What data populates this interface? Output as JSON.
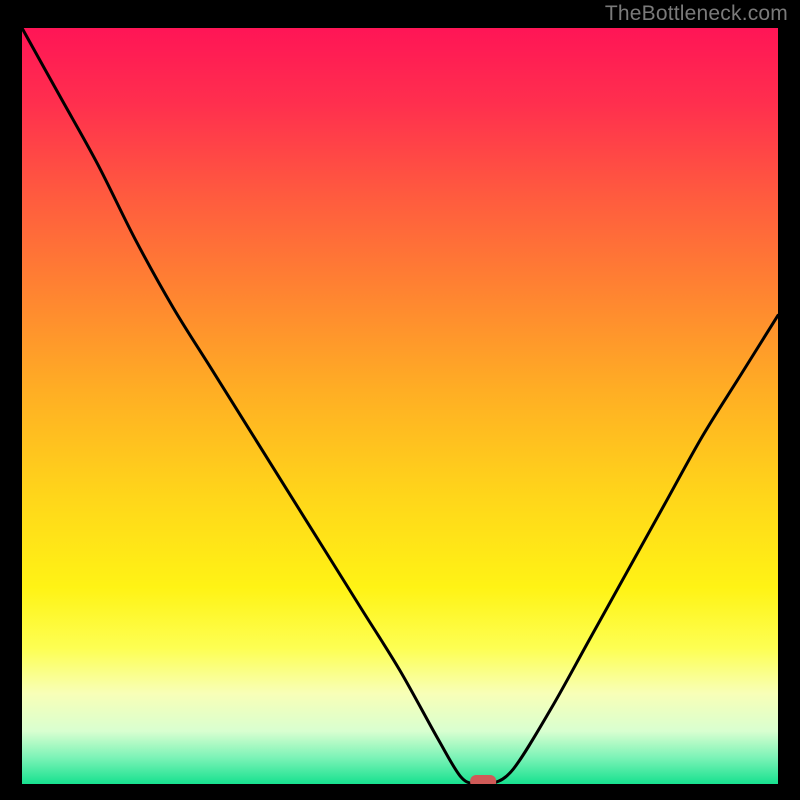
{
  "watermark": "TheBottleneck.com",
  "chart_data": {
    "type": "line",
    "title": "",
    "xlabel": "",
    "ylabel": "",
    "xlim": [
      0,
      100
    ],
    "ylim": [
      0,
      100
    ],
    "grid": false,
    "categories_note": "x is relative position 0–100 along the horizontal axis; values are curve height 0–100 (0 at bottom)",
    "series": [
      {
        "name": "bottleneck-curve",
        "x": [
          0,
          5,
          10,
          15,
          20,
          25,
          30,
          35,
          40,
          45,
          50,
          55,
          58,
          60,
          62,
          65,
          70,
          75,
          80,
          85,
          90,
          95,
          100
        ],
        "values": [
          100,
          91,
          82,
          72,
          63,
          55,
          47,
          39,
          31,
          23,
          15,
          6,
          1,
          0,
          0,
          2,
          10,
          19,
          28,
          37,
          46,
          54,
          62
        ]
      }
    ],
    "marker": {
      "name": "optimum-marker",
      "x": 61,
      "y": 0,
      "color": "#cf5a57"
    },
    "gradient_stops": [
      {
        "offset": 0.0,
        "color": "#ff1556"
      },
      {
        "offset": 0.1,
        "color": "#ff2f4e"
      },
      {
        "offset": 0.22,
        "color": "#ff5a3f"
      },
      {
        "offset": 0.35,
        "color": "#ff8431"
      },
      {
        "offset": 0.48,
        "color": "#ffae24"
      },
      {
        "offset": 0.62,
        "color": "#ffd61a"
      },
      {
        "offset": 0.74,
        "color": "#fff315"
      },
      {
        "offset": 0.82,
        "color": "#fdff52"
      },
      {
        "offset": 0.88,
        "color": "#f8ffb7"
      },
      {
        "offset": 0.93,
        "color": "#d9ffd0"
      },
      {
        "offset": 0.965,
        "color": "#7cf3b7"
      },
      {
        "offset": 1.0,
        "color": "#17e18f"
      }
    ]
  }
}
